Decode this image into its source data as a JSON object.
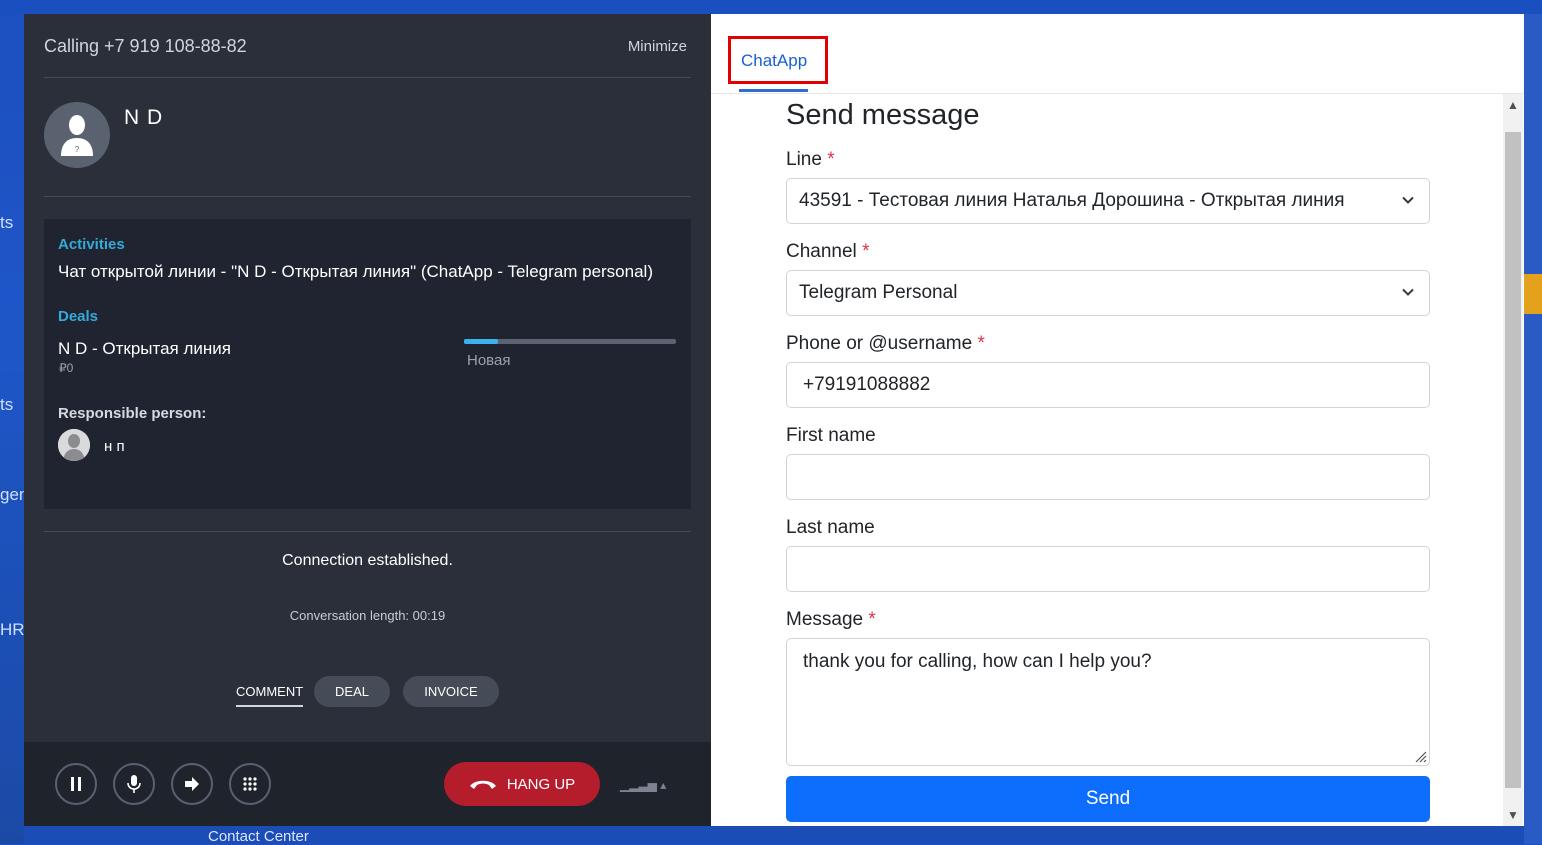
{
  "background": {
    "left_fragments": [
      "ts",
      "ts",
      "gen",
      "HR"
    ],
    "bottom_tab": "Contact Center"
  },
  "call": {
    "title": "Calling +7 919 108-88-82",
    "minimize": "Minimize",
    "contact_name": "N D",
    "activities_label": "Activities",
    "activity_text": "Чат открытой линии - \"N D - Открытая линия\" (ChatApp - Telegram personal)",
    "deals_label": "Deals",
    "deal_name": "N D - Открытая линия",
    "deal_sum": "₽0",
    "deal_stage": "Новая",
    "deal_progress": 0.16,
    "responsible_label": "Responsible person:",
    "responsible_name": "н п",
    "connection_status": "Connection established.",
    "conversation_length": "Conversation length: 00:19",
    "tabs": {
      "comment": "COMMENT",
      "deal": "DEAL",
      "invoice": "INVOICE"
    },
    "hangup": "HANG UP"
  },
  "chatapp": {
    "tab_label": "ChatApp",
    "form_title": "Send message",
    "line_label": "Line",
    "line_value": "43591 - Тестовая линия Наталья Дорошина - Открытая линия",
    "channel_label": "Channel",
    "channel_value": "Telegram Personal",
    "phone_label": "Phone or @username",
    "phone_value": "+79191088882",
    "first_name_label": "First name",
    "first_name_value": "",
    "last_name_label": "Last name",
    "last_name_value": "",
    "message_label": "Message",
    "message_value": "thank you for calling, how can I help you?",
    "required_mark": "*",
    "send": "Send"
  },
  "colors": {
    "accent_blue": "#0d6efd",
    "hangup_red": "#b51c2c",
    "section_label": "#35a9d9",
    "highlight_box": "#e10000"
  }
}
